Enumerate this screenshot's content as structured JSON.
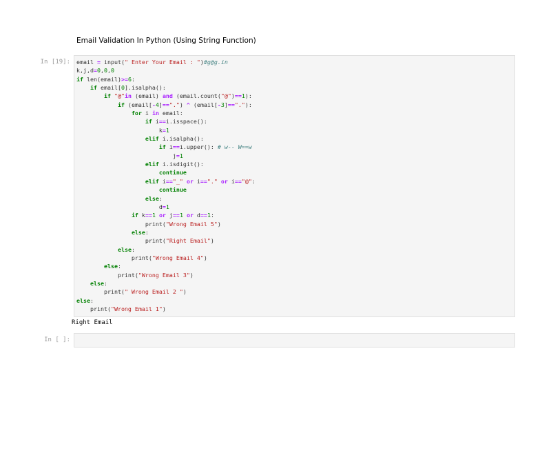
{
  "markdown": {
    "title": "Email Validation In Python (Using String Function)"
  },
  "cells": [
    {
      "prompt": "In [19]:",
      "code_lines": [
        [
          [
            "t",
            "email "
          ],
          [
            "o",
            "="
          ],
          [
            "t",
            " input("
          ],
          [
            "s",
            "\" Enter Your Email : \""
          ],
          [
            "t",
            ")"
          ],
          [
            "c",
            "#g@g.in"
          ]
        ],
        [
          [
            "t",
            "k,j,d"
          ],
          [
            "o",
            "="
          ],
          [
            "n",
            "0"
          ],
          [
            "t",
            ","
          ],
          [
            "n",
            "0"
          ],
          [
            "t",
            ","
          ],
          [
            "n",
            "0"
          ]
        ],
        [
          [
            "k",
            "if"
          ],
          [
            "t",
            " len(email)"
          ],
          [
            "o",
            ">="
          ],
          [
            "n",
            "6"
          ],
          [
            "t",
            ":"
          ]
        ],
        [
          [
            "t",
            "    "
          ],
          [
            "k",
            "if"
          ],
          [
            "t",
            " email["
          ],
          [
            "n",
            "0"
          ],
          [
            "t",
            "].isalpha():"
          ]
        ],
        [
          [
            "t",
            "        "
          ],
          [
            "k",
            "if"
          ],
          [
            "t",
            " "
          ],
          [
            "s",
            "\"@\""
          ],
          [
            "o",
            "in"
          ],
          [
            "t",
            " (email) "
          ],
          [
            "o",
            "and"
          ],
          [
            "t",
            " (email.count("
          ],
          [
            "s",
            "\"@\""
          ],
          [
            "t",
            ")"
          ],
          [
            "o",
            "=="
          ],
          [
            "n",
            "1"
          ],
          [
            "t",
            "):"
          ]
        ],
        [
          [
            "t",
            "            "
          ],
          [
            "k",
            "if"
          ],
          [
            "t",
            " (email["
          ],
          [
            "o",
            "-"
          ],
          [
            "n",
            "4"
          ],
          [
            "t",
            "]"
          ],
          [
            "o",
            "=="
          ],
          [
            "s",
            "\".\""
          ],
          [
            "t",
            ") "
          ],
          [
            "o",
            "^"
          ],
          [
            "t",
            " (email["
          ],
          [
            "o",
            "-"
          ],
          [
            "n",
            "3"
          ],
          [
            "t",
            "]"
          ],
          [
            "o",
            "=="
          ],
          [
            "s",
            "\".\""
          ],
          [
            "t",
            "):"
          ]
        ],
        [
          [
            "t",
            "                "
          ],
          [
            "k",
            "for"
          ],
          [
            "t",
            " i "
          ],
          [
            "o",
            "in"
          ],
          [
            "t",
            " email:"
          ]
        ],
        [
          [
            "t",
            "                    "
          ],
          [
            "k",
            "if"
          ],
          [
            "t",
            " i"
          ],
          [
            "o",
            "=="
          ],
          [
            "t",
            "i.isspace():"
          ]
        ],
        [
          [
            "t",
            "                        k"
          ],
          [
            "o",
            "="
          ],
          [
            "n",
            "1"
          ]
        ],
        [
          [
            "t",
            "                    "
          ],
          [
            "k",
            "elif"
          ],
          [
            "t",
            " i.isalpha():"
          ]
        ],
        [
          [
            "t",
            "                        "
          ],
          [
            "k",
            "if"
          ],
          [
            "t",
            " i"
          ],
          [
            "o",
            "=="
          ],
          [
            "t",
            "i.upper(): "
          ],
          [
            "c",
            "# w-- W==w"
          ]
        ],
        [
          [
            "t",
            "                            j"
          ],
          [
            "o",
            "="
          ],
          [
            "n",
            "1"
          ]
        ],
        [
          [
            "t",
            "                    "
          ],
          [
            "k",
            "elif"
          ],
          [
            "t",
            " i.isdigit():"
          ]
        ],
        [
          [
            "t",
            "                        "
          ],
          [
            "k",
            "continue"
          ]
        ],
        [
          [
            "t",
            "                    "
          ],
          [
            "k",
            "elif"
          ],
          [
            "t",
            " i"
          ],
          [
            "o",
            "=="
          ],
          [
            "s",
            "\"_\""
          ],
          [
            "t",
            " "
          ],
          [
            "o",
            "or"
          ],
          [
            "t",
            " i"
          ],
          [
            "o",
            "=="
          ],
          [
            "s",
            "\".\""
          ],
          [
            "t",
            " "
          ],
          [
            "o",
            "or"
          ],
          [
            "t",
            " i"
          ],
          [
            "o",
            "=="
          ],
          [
            "s",
            "\"@\""
          ],
          [
            "t",
            ":"
          ]
        ],
        [
          [
            "t",
            "                        "
          ],
          [
            "k",
            "continue"
          ]
        ],
        [
          [
            "t",
            "                    "
          ],
          [
            "k",
            "else"
          ],
          [
            "t",
            ":"
          ]
        ],
        [
          [
            "t",
            "                        d"
          ],
          [
            "o",
            "="
          ],
          [
            "n",
            "1"
          ]
        ],
        [
          [
            "t",
            "                "
          ],
          [
            "k",
            "if"
          ],
          [
            "t",
            " k"
          ],
          [
            "o",
            "=="
          ],
          [
            "n",
            "1"
          ],
          [
            "t",
            " "
          ],
          [
            "o",
            "or"
          ],
          [
            "t",
            " j"
          ],
          [
            "o",
            "=="
          ],
          [
            "n",
            "1"
          ],
          [
            "t",
            " "
          ],
          [
            "o",
            "or"
          ],
          [
            "t",
            " d"
          ],
          [
            "o",
            "=="
          ],
          [
            "n",
            "1"
          ],
          [
            "t",
            ":"
          ]
        ],
        [
          [
            "t",
            "                    print("
          ],
          [
            "s",
            "\"Wrong Email 5\""
          ],
          [
            "t",
            ")"
          ]
        ],
        [
          [
            "t",
            "                "
          ],
          [
            "k",
            "else"
          ],
          [
            "t",
            ":"
          ]
        ],
        [
          [
            "t",
            "                    print("
          ],
          [
            "s",
            "\"Right Email\""
          ],
          [
            "t",
            ")"
          ]
        ],
        [
          [
            "t",
            "            "
          ],
          [
            "k",
            "else"
          ],
          [
            "t",
            ":"
          ]
        ],
        [
          [
            "t",
            "                print("
          ],
          [
            "s",
            "\"Wrong Email 4\""
          ],
          [
            "t",
            ")"
          ]
        ],
        [
          [
            "t",
            "        "
          ],
          [
            "k",
            "else"
          ],
          [
            "t",
            ":"
          ]
        ],
        [
          [
            "t",
            "            print("
          ],
          [
            "s",
            "\"Wrong Email 3\""
          ],
          [
            "t",
            ")"
          ]
        ],
        [
          [
            "t",
            "    "
          ],
          [
            "k",
            "else"
          ],
          [
            "t",
            ":"
          ]
        ],
        [
          [
            "t",
            "        print("
          ],
          [
            "s",
            "\" Wrong Email 2 \""
          ],
          [
            "t",
            ")"
          ]
        ],
        [
          [
            "k",
            "else"
          ],
          [
            "t",
            ":"
          ]
        ],
        [
          [
            "t",
            "    print("
          ],
          [
            "s",
            "\"Wrong Email 1\""
          ],
          [
            "t",
            ")"
          ]
        ]
      ],
      "output": "Right Email"
    },
    {
      "prompt": "In [ ]:"
    }
  ]
}
